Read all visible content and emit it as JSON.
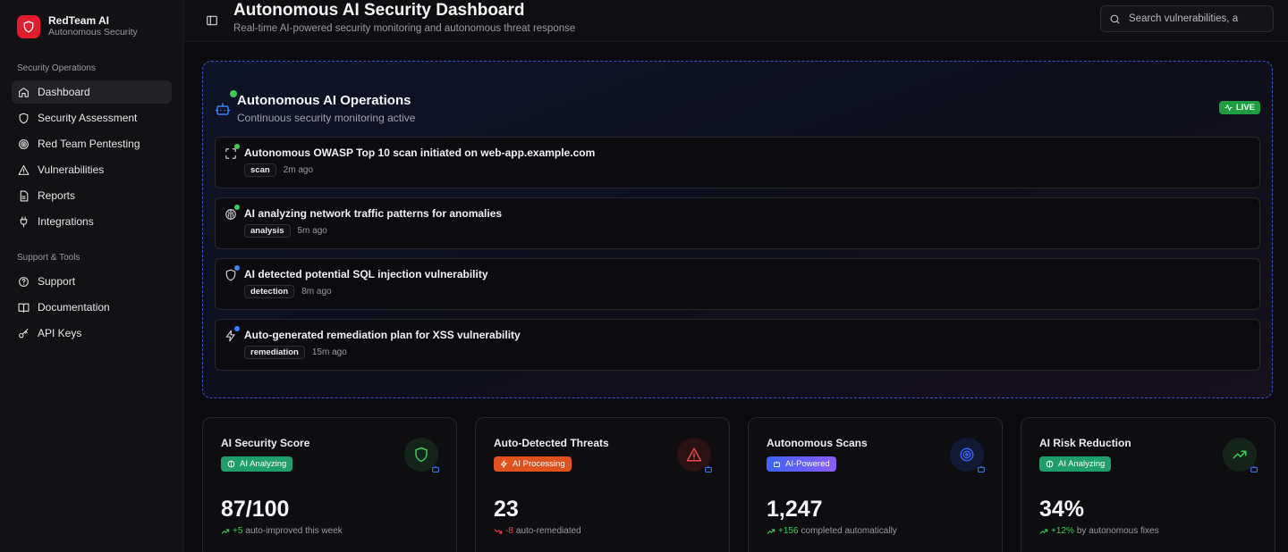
{
  "brand": {
    "name": "RedTeam AI",
    "subtitle": "Autonomous Security",
    "color": "#e11d2e"
  },
  "sidebar": {
    "sections": [
      {
        "label": "Security Operations",
        "items": [
          {
            "label": "Dashboard",
            "icon": "home-icon",
            "active": true
          },
          {
            "label": "Security Assessment",
            "icon": "shield-icon"
          },
          {
            "label": "Red Team Pentesting",
            "icon": "target-icon"
          },
          {
            "label": "Vulnerabilities",
            "icon": "warning-icon"
          },
          {
            "label": "Reports",
            "icon": "document-icon"
          },
          {
            "label": "Integrations",
            "icon": "plug-icon"
          }
        ]
      },
      {
        "label": "Support & Tools",
        "items": [
          {
            "label": "Support",
            "icon": "help-circle-icon"
          },
          {
            "label": "Documentation",
            "icon": "book-icon"
          },
          {
            "label": "API Keys",
            "icon": "key-icon"
          }
        ]
      }
    ]
  },
  "header": {
    "title": "Autonomous AI Security Dashboard",
    "subtitle": "Real-time AI-powered security monitoring and autonomous threat response",
    "search_placeholder": "Search vulnerabilities, a"
  },
  "ops": {
    "title": "Autonomous AI Operations",
    "subtitle": "Continuous security monitoring active",
    "live_label": "LIVE",
    "accent": "#3a53c9",
    "events": [
      {
        "text": "Autonomous OWASP Top 10 scan initiated on web-app.example.com",
        "tag": "scan",
        "time": "2m ago",
        "icon": "scan-icon",
        "dot_color": "#3fca5a"
      },
      {
        "text": "AI analyzing network traffic patterns for anomalies",
        "tag": "analysis",
        "time": "5m ago",
        "icon": "brain-icon",
        "dot_color": "#3fca5a"
      },
      {
        "text": "AI detected potential SQL injection vulnerability",
        "tag": "detection",
        "time": "8m ago",
        "icon": "shield-icon",
        "dot_color": "#3b82f6"
      },
      {
        "text": "Auto-generated remediation plan for XSS vulnerability",
        "tag": "remediation",
        "time": "15m ago",
        "icon": "lightning-icon",
        "dot_color": "#3b82f6"
      }
    ]
  },
  "cards": [
    {
      "title": "AI Security Score",
      "badge": "AI Analyzing",
      "badge_color": "#1f9e6a",
      "value": "87/100",
      "delta": "+5",
      "delta_dir": "up",
      "delta_text": "auto-improved this week",
      "icon": "shield-icon",
      "icon_color": "#3fca5a"
    },
    {
      "title": "Auto-Detected Threats",
      "badge": "AI Processing",
      "badge_color": "#e0521d",
      "value": "23",
      "delta": "-8",
      "delta_dir": "down",
      "delta_text": "auto-remediated",
      "icon": "alert-triangle-icon",
      "icon_color": "#e5484d"
    },
    {
      "title": "Autonomous Scans",
      "badge": "AI-Powered",
      "badge_color": "#5b5cf0",
      "value": "1,247",
      "delta": "+156",
      "delta_dir": "up",
      "delta_text": "completed automatically",
      "icon": "target-icon",
      "icon_color": "#3b63f5"
    },
    {
      "title": "AI Risk Reduction",
      "badge": "AI Analyzing",
      "badge_color": "#1f9e6a",
      "value": "34%",
      "delta": "+12%",
      "delta_dir": "up",
      "delta_text": "by autonomous fixes",
      "icon": "trending-up-icon",
      "icon_color": "#3fca5a"
    }
  ]
}
